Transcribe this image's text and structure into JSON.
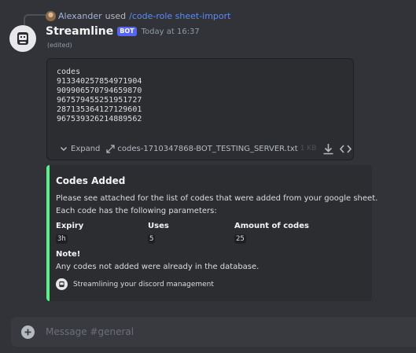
{
  "reply": {
    "user": "Alexander",
    "used_text": "used",
    "command": "/code-role sheet-import"
  },
  "message": {
    "author": "Streamline",
    "bot_tag": "BOT",
    "timestamp": "Today at 16:37",
    "edited": "(edited)"
  },
  "attachment": {
    "code_lines": [
      "codes",
      "913340257854971904",
      "909906570794659870",
      "967579455251951727",
      "287135364127129601",
      "967539326214889562"
    ],
    "expand_label": "Expand",
    "filename": "codes-1710347868-BOT_TESTING_SERVER.txt",
    "filesize": "1 KB",
    "icons": [
      "chevron-down-icon",
      "diagonal-expand-icon",
      "download-icon",
      "code-icon"
    ]
  },
  "embed": {
    "accent_color": "#57f287",
    "title": "Codes Added",
    "description_lines": [
      "Please see attached for the list of codes that were added from your google sheet.",
      "Each code has the following parameters:"
    ],
    "fields": [
      {
        "name": "Expiry",
        "value": "3h"
      },
      {
        "name": "Uses",
        "value": "5"
      },
      {
        "name": "Amount of codes",
        "value": "25"
      }
    ],
    "note_title": "Note!",
    "note_text": "Any codes not added were already in the database.",
    "footer": "Streamlining your discord management"
  },
  "composer": {
    "placeholder": "Message #general"
  },
  "colors": {
    "background": "#313338",
    "embed_background": "#2b2d31",
    "bot_tag": "#5865f2",
    "link": "#5b8cf0"
  }
}
